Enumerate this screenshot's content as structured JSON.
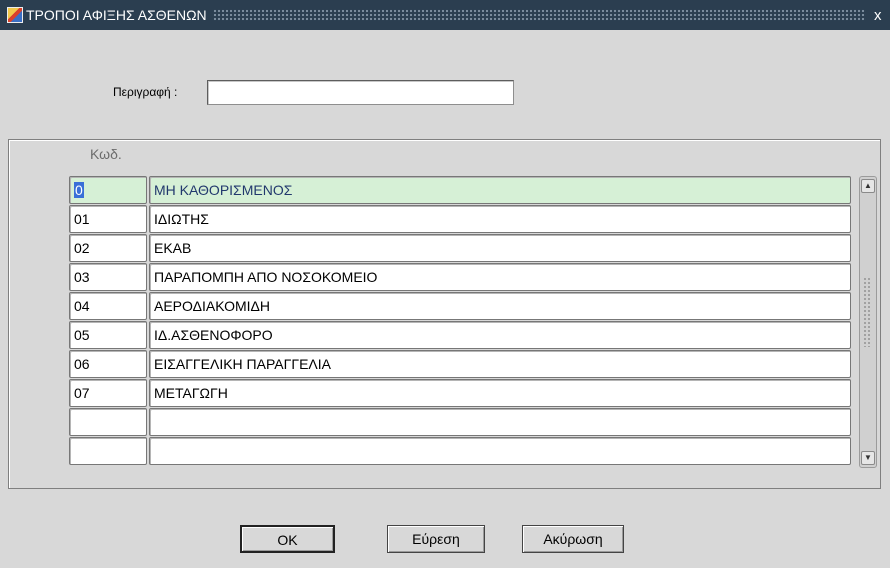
{
  "window": {
    "title": "ΤΡΟΠΟΙ ΑΦΙΞΗΣ ΑΣΘΕΝΩΝ",
    "close_glyph": "x",
    "icon": "form-app-icon"
  },
  "filter": {
    "label": "Περιγραφή :",
    "value": ""
  },
  "table": {
    "header_code": "Κωδ.",
    "rows": [
      {
        "code": "0",
        "desc": "ΜΗ ΚΑΘΟΡΙΣΜΕΝΟΣ"
      },
      {
        "code": "01",
        "desc": "ΙΔΙΩΤΗΣ"
      },
      {
        "code": "02",
        "desc": "ΕΚΑΒ"
      },
      {
        "code": "03",
        "desc": "ΠΑΡΑΠΟΜΠΗ ΑΠΟ ΝΟΣΟΚΟΜΕΙΟ"
      },
      {
        "code": "04",
        "desc": "ΑΕΡΟΔΙΑΚΟΜΙΔΗ"
      },
      {
        "code": "05",
        "desc": "ΙΔ.ΑΣΘΕΝΟΦΟΡΟ"
      },
      {
        "code": "06",
        "desc": "ΕΙΣΑΓΓΕΛΙΚΗ ΠΑΡΑΓΓΕΛΙΑ"
      },
      {
        "code": "07",
        "desc": "ΜΕΤΑΓΩΓΗ"
      },
      {
        "code": "",
        "desc": ""
      },
      {
        "code": "",
        "desc": ""
      }
    ],
    "selected_row": 0,
    "selected_color": "#d6f0d6"
  },
  "buttons": {
    "ok": {
      "label": "OK"
    },
    "find": {
      "label": "Εύρεση"
    },
    "cancel": {
      "label": "Ακύρωση"
    }
  },
  "colors": {
    "titlebar": "#2b3e50",
    "background": "#d8d8d8",
    "text_selection": "#3a6fd8"
  }
}
